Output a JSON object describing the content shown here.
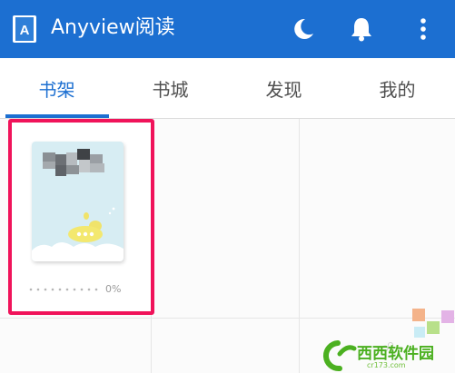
{
  "app": {
    "title": "Anyview阅读",
    "logo_letter": "A",
    "bar_color": "#1c6fd1",
    "icons": [
      "moon-icon",
      "bell-icon",
      "more-vert-icon"
    ]
  },
  "tabs": [
    {
      "label": "书架",
      "active": true
    },
    {
      "label": "书城",
      "active": false
    },
    {
      "label": "发现",
      "active": false
    },
    {
      "label": "我的",
      "active": false
    }
  ],
  "accent_color": "#1c6fd1",
  "highlight_color": "#f0135a",
  "bookshelf": {
    "books": [
      {
        "progress_text": "0%",
        "progress": 0.0
      }
    ]
  },
  "watermark": {
    "name": "西西软件园",
    "url": "cr173.com"
  }
}
